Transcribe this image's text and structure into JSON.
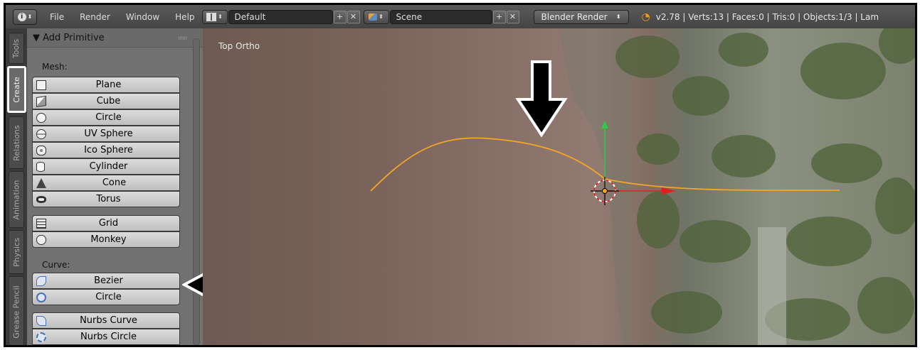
{
  "topbar": {
    "info_icon": "info-icon",
    "menus": [
      "File",
      "Render",
      "Window",
      "Help"
    ],
    "layout_value": "Default",
    "scene_value": "Scene",
    "engine": "Blender Render",
    "stats": "v2.78 | Verts:13 | Faces:0 | Tris:0 | Objects:1/3 | Lam"
  },
  "tabs": [
    "Tools",
    "Create",
    "Relations",
    "Animation",
    "Physics",
    "Grease Pencil"
  ],
  "active_tab": "Create",
  "panel": {
    "title": "▼ Add Primitive",
    "mesh_label": "Mesh:",
    "mesh": [
      "Plane",
      "Cube",
      "Circle",
      "UV Sphere",
      "Ico Sphere",
      "Cylinder",
      "Cone",
      "Torus"
    ],
    "mesh_extra": [
      "Grid",
      "Monkey"
    ],
    "curve_label": "Curve:",
    "curve": [
      "Bezier",
      "Circle"
    ],
    "nurbs": [
      "Nurbs Curve",
      "Nurbs Circle"
    ]
  },
  "viewport": {
    "title": "Top Ortho",
    "curve_color": "#f5a623",
    "y_axis_color": "#2ecc40",
    "x_axis_color": "#e02020"
  }
}
